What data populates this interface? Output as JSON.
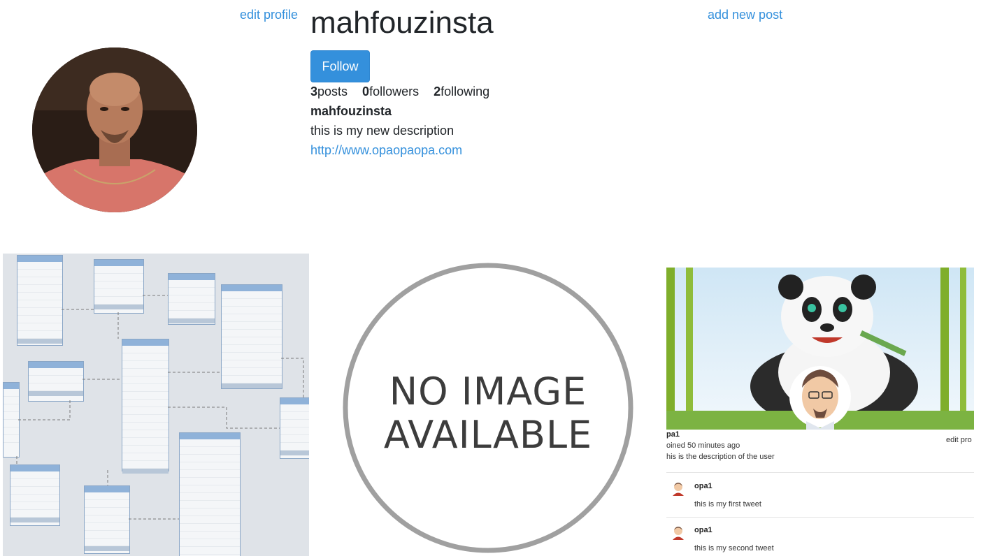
{
  "header": {
    "edit_profile": "edit profile",
    "add_new_post": "add new post"
  },
  "profile": {
    "username": "mahfouzinsta",
    "follow_label": "Follow",
    "posts_count": "3",
    "posts_label": "posts",
    "followers_count": "0",
    "followers_label": "followers",
    "following_count": "2",
    "following_label": "following",
    "title": "mahfouzinsta",
    "description": "this is my new description",
    "url": "http://www.opaopaopa.com"
  },
  "posts": {
    "post2_line1": "NO IMAGE",
    "post2_line2": "AVAILABLE",
    "post3": {
      "username": "pa1",
      "edit_profile": "edit pro",
      "joined": "oined 50 minutes ago",
      "description": "his is the description of the user",
      "tweets": [
        {
          "author": "opa1",
          "text": "this is my first tweet"
        },
        {
          "author": "opa1",
          "text": "this is my second tweet"
        }
      ]
    }
  },
  "colors": {
    "accent": "#3490dc",
    "text": "#212529"
  }
}
